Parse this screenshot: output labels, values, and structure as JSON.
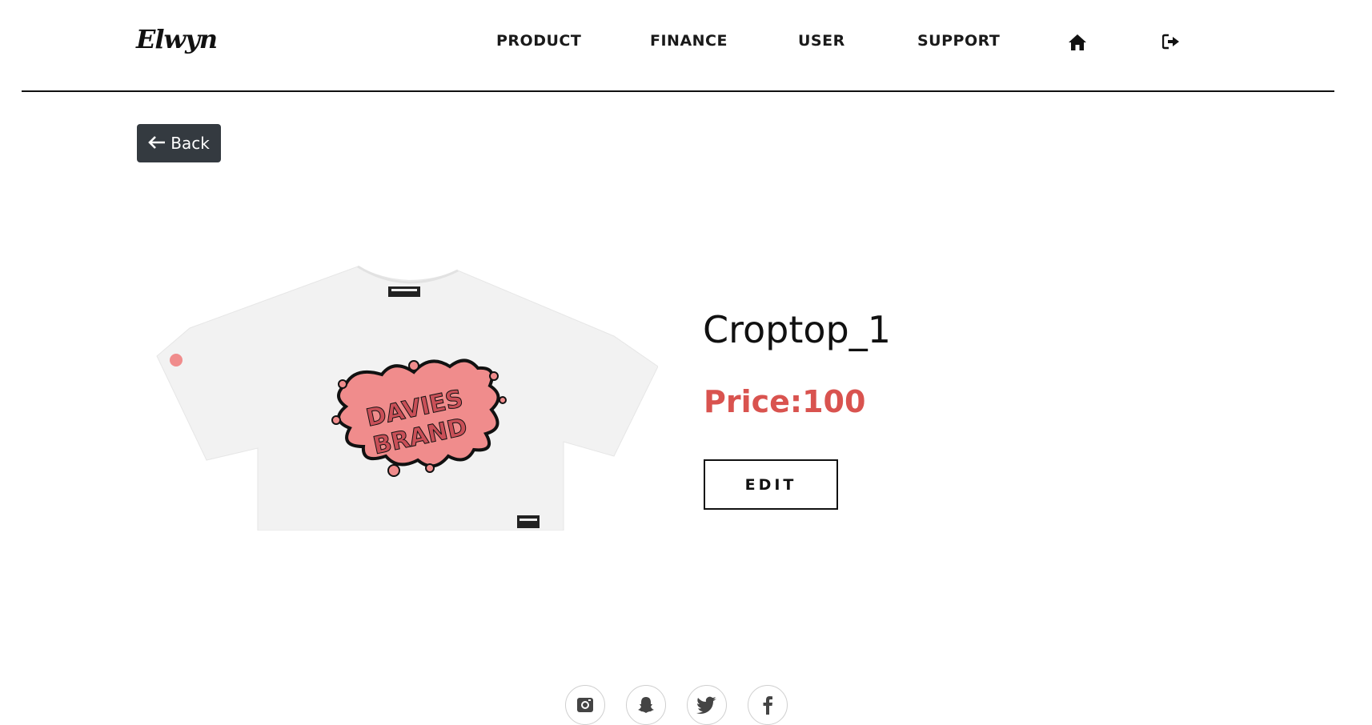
{
  "brand": {
    "logo_text": "Elwyn"
  },
  "nav": {
    "items": [
      {
        "label": "PRODUCT"
      },
      {
        "label": "FINANCE"
      },
      {
        "label": "USER"
      },
      {
        "label": "SUPPORT"
      }
    ],
    "icons": [
      "home-icon",
      "logout-icon"
    ]
  },
  "back_button": {
    "label": "Back",
    "icon": "arrow-left-icon"
  },
  "product": {
    "name": "Croptop_1",
    "price_text": "Price:100",
    "edit_label": "EDIT",
    "image_brand_text": [
      "DAVIES",
      "BRAND"
    ]
  },
  "footer": {
    "social_icons": [
      "instagram-icon",
      "snapchat-icon",
      "twitter-icon",
      "facebook-icon"
    ]
  },
  "colors": {
    "price": "#d9534f",
    "back_button_bg": "#343a40",
    "splash_pink": "#f08c8c"
  }
}
